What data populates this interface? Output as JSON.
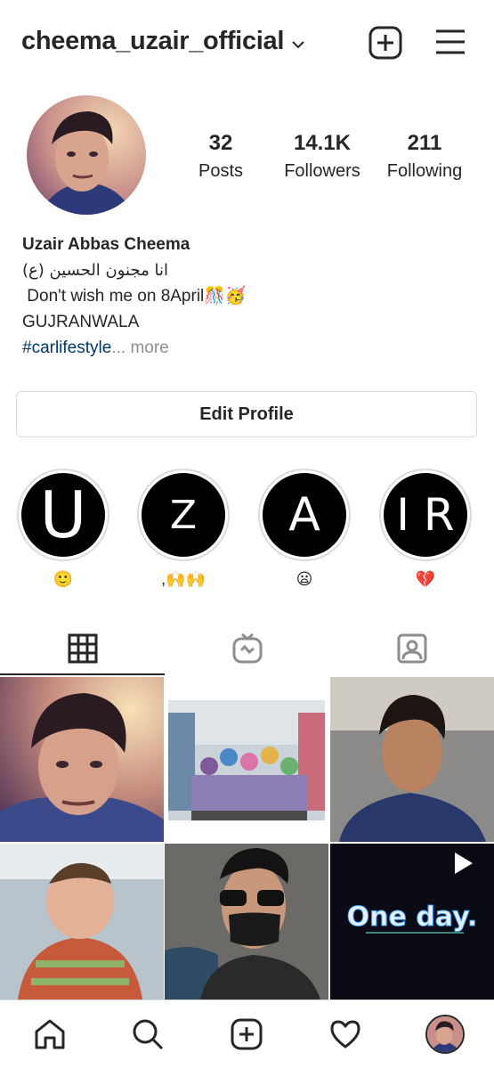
{
  "header": {
    "username": "cheema_uzair_official",
    "icons": [
      "chevron-down-icon",
      "new-post-icon",
      "menu-icon"
    ]
  },
  "stats": [
    {
      "value": "32",
      "label": "Posts"
    },
    {
      "value": "14.1K",
      "label": "Followers"
    },
    {
      "value": "211",
      "label": "Following"
    }
  ],
  "bio": {
    "name": "Uzair Abbas Cheema",
    "line1": "انا مجنون الحسين (ع)",
    "line2": " Don't wish me on 8April🎊🥳",
    "line3": "GUJRANWALA",
    "hashtag": "#carlifestyle",
    "ellipsis": "...",
    "more": " more"
  },
  "edit_profile_label": "Edit Profile",
  "highlights": [
    {
      "letter": "U",
      "label": "🙂"
    },
    {
      "letter": "Z",
      "label": ",🙌🙌"
    },
    {
      "letter": "A",
      "label": "😦"
    },
    {
      "letter": "I R",
      "label": "💔"
    }
  ],
  "tabs": [
    "grid-icon",
    "igtv-icon",
    "tagged-icon"
  ],
  "grid": {
    "overlay_text": "One day."
  },
  "bottom_nav": [
    "home-icon",
    "search-icon",
    "add-icon",
    "activity-heart-icon",
    "profile-avatar"
  ]
}
